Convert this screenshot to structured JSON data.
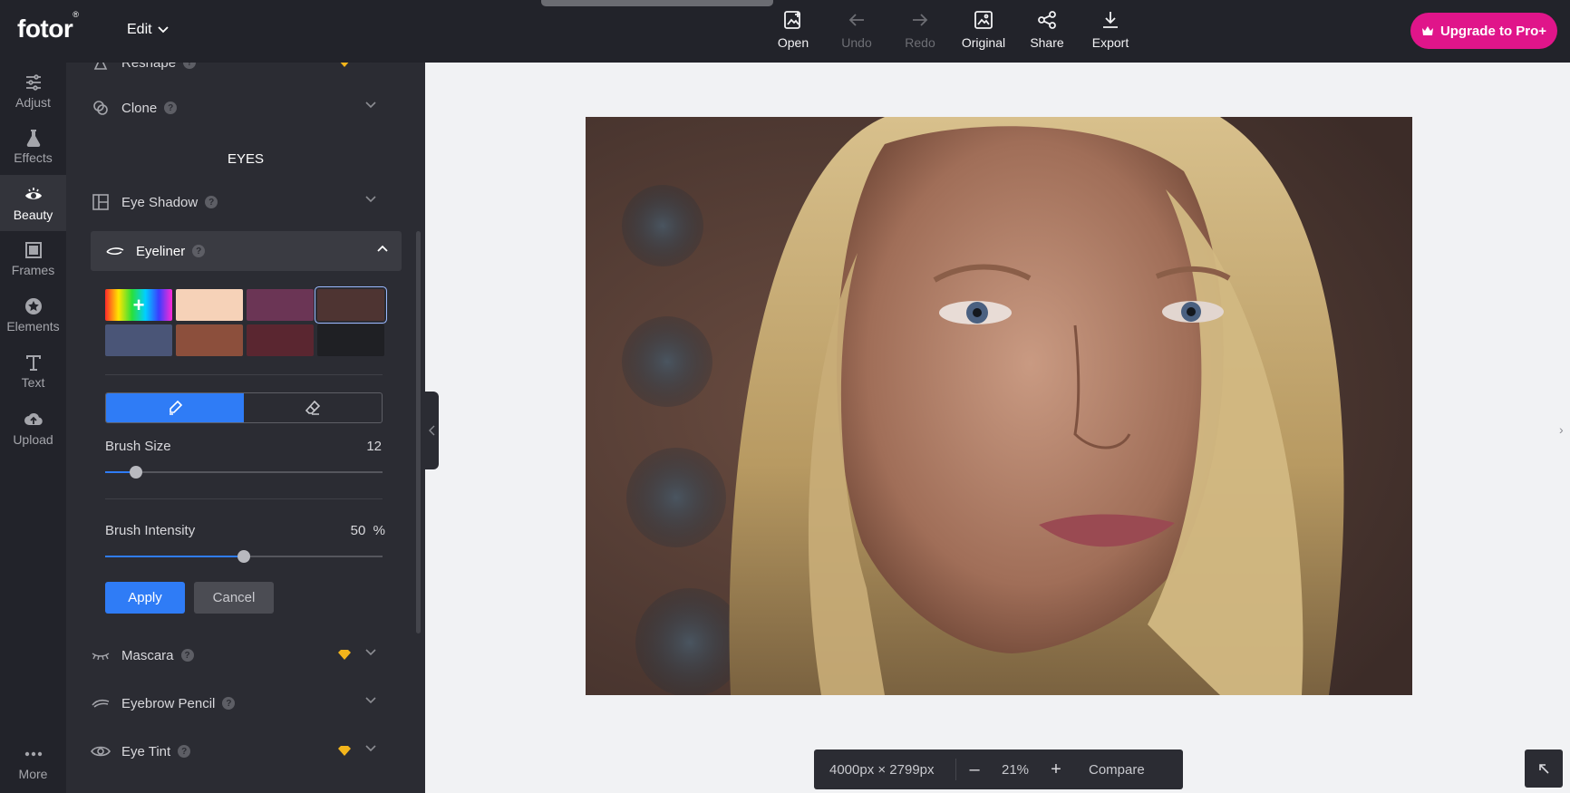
{
  "app": {
    "logo": "fotor",
    "logo_mark": "®",
    "edit_label": "Edit"
  },
  "toolbar": [
    {
      "label": "Open",
      "icon": "open-image-icon",
      "enabled": true
    },
    {
      "label": "Undo",
      "icon": "undo-arrow-icon",
      "enabled": false
    },
    {
      "label": "Redo",
      "icon": "redo-arrow-icon",
      "enabled": false
    },
    {
      "label": "Original",
      "icon": "original-image-icon",
      "enabled": true
    },
    {
      "label": "Share",
      "icon": "share-icon",
      "enabled": true
    },
    {
      "label": "Export",
      "icon": "download-icon",
      "enabled": true
    }
  ],
  "upgrade": {
    "label": "Upgrade to Pro+",
    "color": "#e0158a"
  },
  "nav": [
    {
      "label": "Adjust",
      "icon": "sliders-icon",
      "active": false
    },
    {
      "label": "Effects",
      "icon": "flask-icon",
      "active": false
    },
    {
      "label": "Beauty",
      "icon": "eye-icon",
      "active": true
    },
    {
      "label": "Frames",
      "icon": "frame-icon",
      "active": false
    },
    {
      "label": "Elements",
      "icon": "elements-icon",
      "active": false
    },
    {
      "label": "Text",
      "icon": "text-icon",
      "active": false
    },
    {
      "label": "Upload",
      "icon": "cloud-upload-icon",
      "active": false
    },
    {
      "label": "More",
      "icon": "more-dots-icon",
      "active": false
    }
  ],
  "panel": {
    "reshape": {
      "label": "Reshape",
      "pro": true
    },
    "clone": {
      "label": "Clone"
    },
    "section_eyes": "EYES",
    "eye_shadow": {
      "label": "Eye Shadow"
    },
    "eyeliner": {
      "label": "Eyeliner",
      "expanded": true
    },
    "swatches": [
      "#rainbow",
      "#f6d2b8",
      "#6b3555",
      "#4e3432",
      "#4a5577",
      "#8c4f3c",
      "#5a2630",
      "#1f2024"
    ],
    "selected_swatch": 3,
    "brush_size": {
      "label": "Brush Size",
      "value": "12",
      "fraction": 0.11
    },
    "brush_intensity": {
      "label": "Brush Intensity",
      "value": "50",
      "unit": "%",
      "fraction": 0.5
    },
    "apply_label": "Apply",
    "cancel_label": "Cancel",
    "mascara": {
      "label": "Mascara",
      "pro": true
    },
    "eyebrow_pencil": {
      "label": "Eyebrow Pencil"
    },
    "eye_tint": {
      "label": "Eye Tint",
      "pro": true
    }
  },
  "bottom": {
    "dimensions": "4000px × 2799px",
    "zoom": "21%",
    "compare_label": "Compare"
  },
  "colors": {
    "accent": "#2f7cf6",
    "panel": "#2b2c33",
    "topbar": "#22232a"
  }
}
